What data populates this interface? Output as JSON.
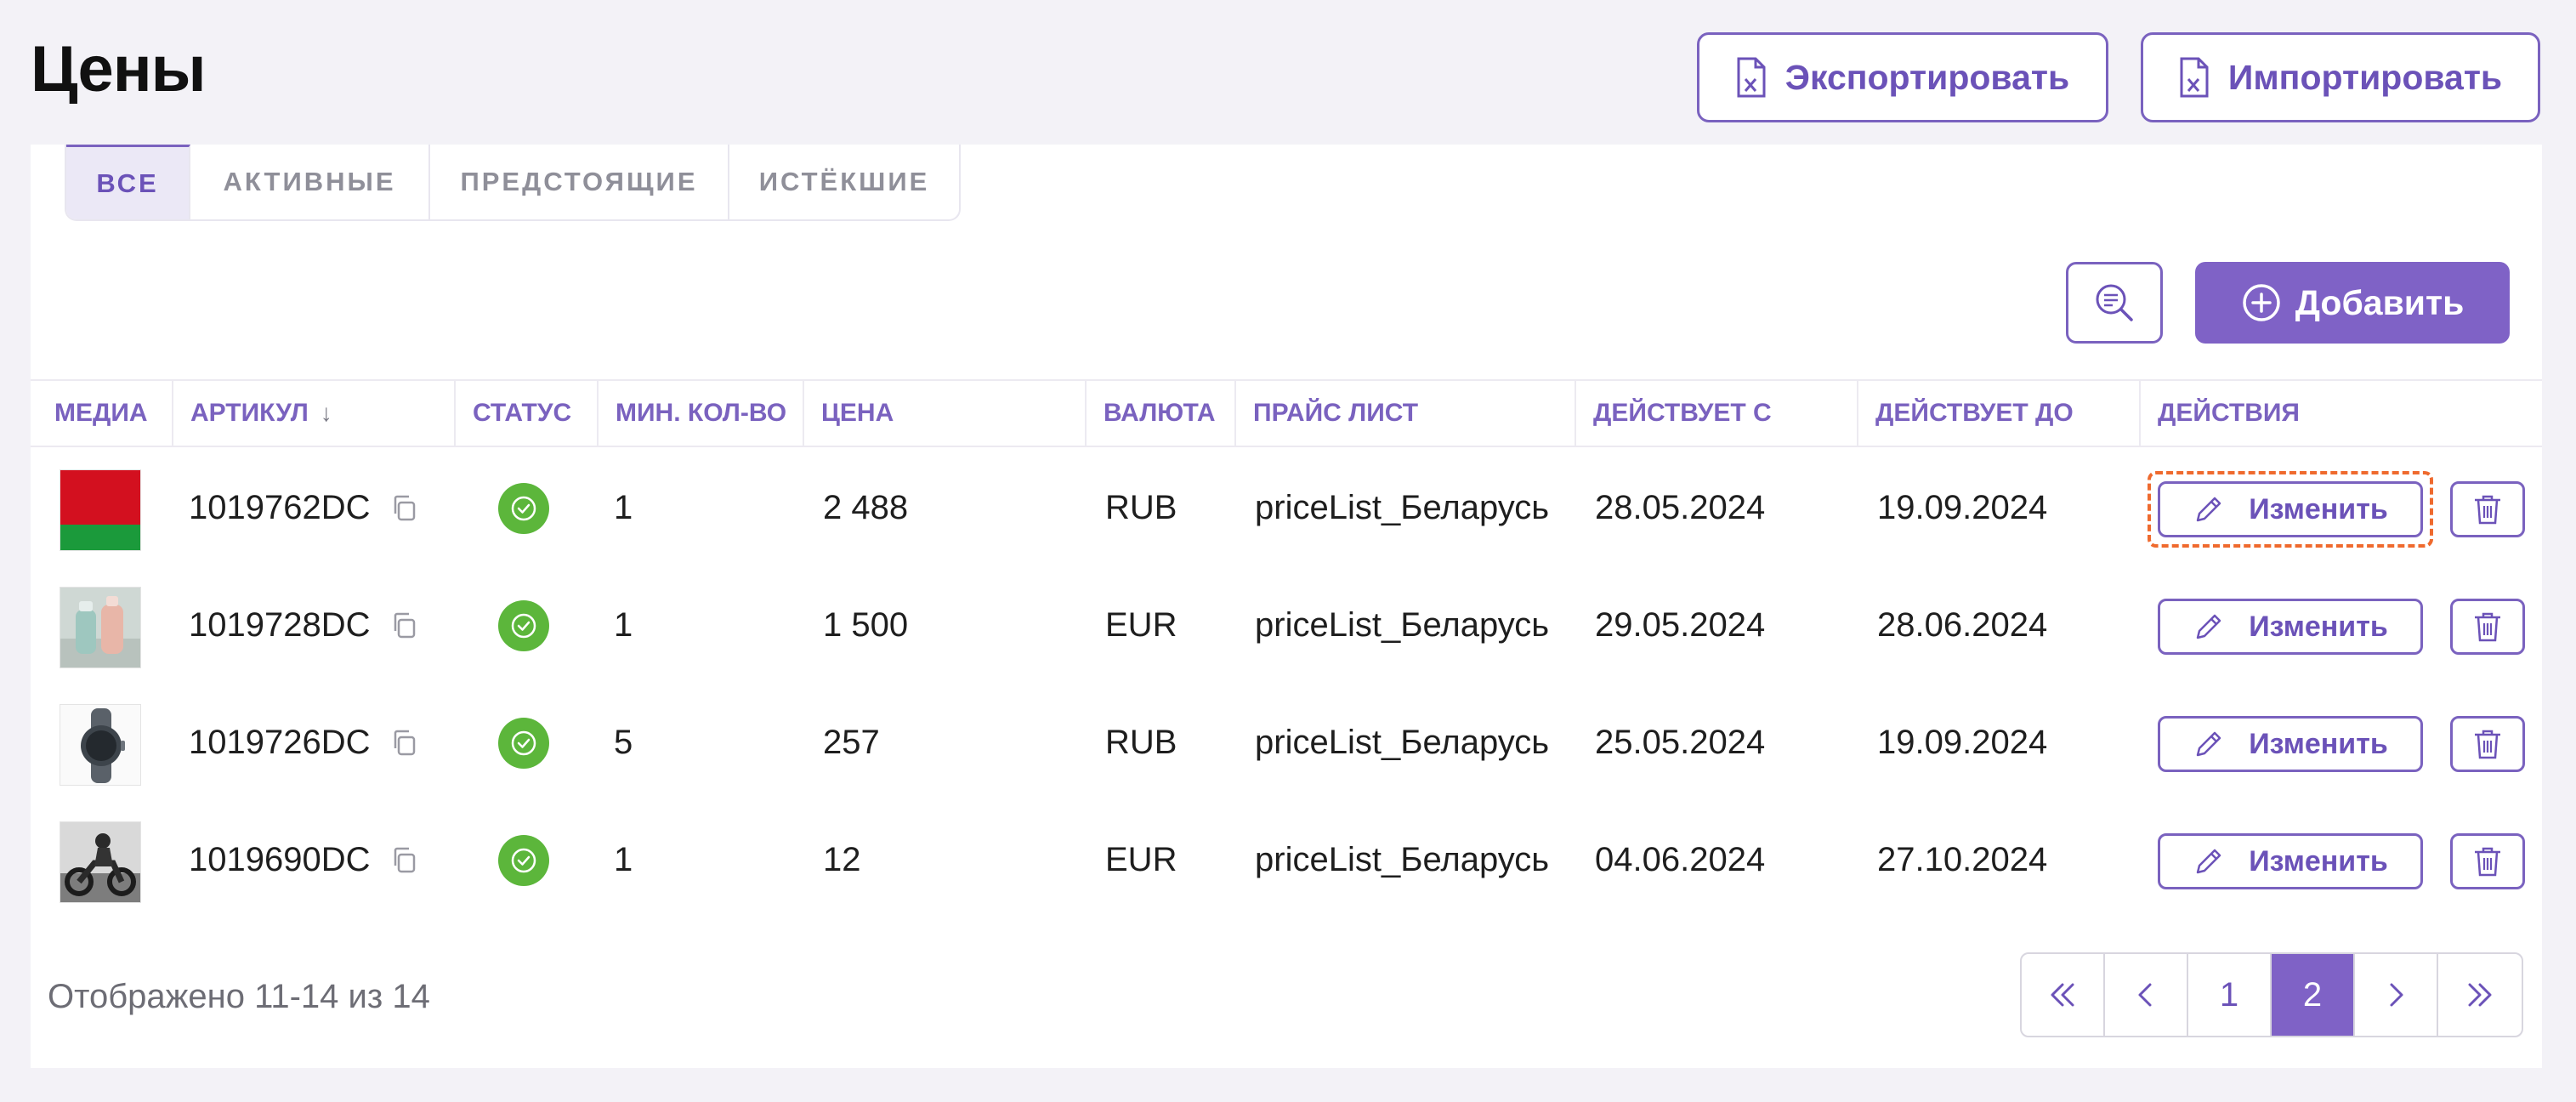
{
  "page": {
    "title": "Цены"
  },
  "toolbar": {
    "export_label": "Экспортировать",
    "import_label": "Импортировать",
    "add_label": "Добавить"
  },
  "tabs": [
    {
      "label": "ВСЕ",
      "active": true
    },
    {
      "label": "АКТИВНЫЕ",
      "active": false
    },
    {
      "label": "ПРЕДСТОЯЩИЕ",
      "active": false
    },
    {
      "label": "ИСТЁКШИЕ",
      "active": false
    }
  ],
  "table": {
    "columns": [
      "МЕДИА",
      "АРТИКУЛ",
      "СТАТУС",
      "МИН. КОЛ-ВО",
      "ЦЕНА",
      "ВАЛЮТА",
      "ПРАЙС ЛИСТ",
      "ДЕЙСТВУЕТ С",
      "ДЕЙСТВУЕТ ДО",
      "ДЕЙСТВИЯ"
    ],
    "sort_indicator": "↓",
    "edit_label": "Изменить",
    "rows": [
      {
        "media": "flag-belarus",
        "sku": "1019762DC",
        "status": "active",
        "min_qty": "1",
        "price": "2 488",
        "currency": "RUB",
        "price_list": "priceList_Беларусь",
        "valid_from": "28.05.2024",
        "valid_to": "19.09.2024"
      },
      {
        "media": "product-bottles",
        "sku": "1019728DC",
        "status": "active",
        "min_qty": "1",
        "price": "1 500",
        "currency": "EUR",
        "price_list": "priceList_Беларусь",
        "valid_from": "29.05.2024",
        "valid_to": "28.06.2024"
      },
      {
        "media": "smartwatch",
        "sku": "1019726DC",
        "status": "active",
        "min_qty": "5",
        "price": "257",
        "currency": "RUB",
        "price_list": "priceList_Беларусь",
        "valid_from": "25.05.2024",
        "valid_to": "19.09.2024"
      },
      {
        "media": "motorcycle-photo",
        "sku": "1019690DC",
        "status": "active",
        "min_qty": "1",
        "price": "12",
        "currency": "EUR",
        "price_list": "priceList_Беларусь",
        "valid_from": "04.06.2024",
        "valid_to": "27.10.2024"
      }
    ]
  },
  "footer": {
    "showing_text": "Отображено 11-14 из 14"
  },
  "pagination": {
    "pages": [
      "1",
      "2"
    ],
    "current": "2"
  },
  "colors": {
    "accent": "#7f62c6",
    "status_active": "#5cb63b",
    "focus_outline": "#ef6a2e"
  }
}
